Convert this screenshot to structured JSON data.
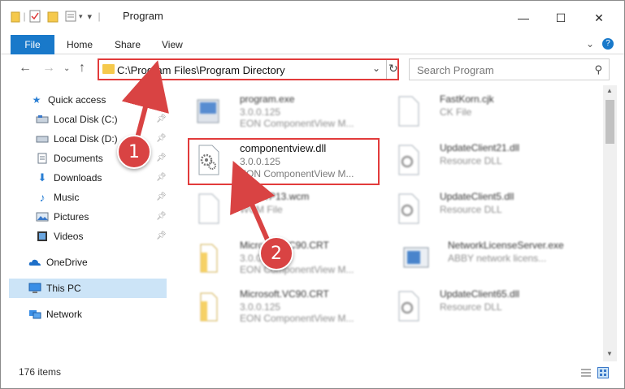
{
  "window": {
    "title": "Program",
    "buttons": {
      "minimize": "—",
      "maximize": "☐",
      "close": "✕"
    }
  },
  "ribbon": {
    "tabs": [
      "File",
      "Home",
      "Share",
      "View"
    ],
    "expand_icon": "⌄",
    "help_icon": "?"
  },
  "nav": {
    "address": "C:\\Program Files\\Program Directory",
    "search_placeholder": "Search Program"
  },
  "sidebar": {
    "items": [
      {
        "label": "Quick access",
        "icon": "star-icon",
        "pinned": false
      },
      {
        "label": "Local Disk (C:)",
        "icon": "drive-icon",
        "pinned": true
      },
      {
        "label": "Local Disk (D:)",
        "icon": "drive-icon",
        "pinned": true
      },
      {
        "label": "Documents",
        "icon": "documents-icon",
        "pinned": true
      },
      {
        "label": "Downloads",
        "icon": "download-icon",
        "pinned": true
      },
      {
        "label": "Music",
        "icon": "music-icon",
        "pinned": true
      },
      {
        "label": "Pictures",
        "icon": "pictures-icon",
        "pinned": true
      },
      {
        "label": "Videos",
        "icon": "videos-icon",
        "pinned": true
      },
      {
        "label": "OneDrive",
        "icon": "cloud-icon",
        "pinned": false
      },
      {
        "label": "This PC",
        "icon": "computer-icon",
        "pinned": false
      },
      {
        "label": "Network",
        "icon": "network-icon",
        "pinned": false
      }
    ]
  },
  "files": [
    {
      "name": "program.exe",
      "line2": "3.0.0.125",
      "line3": "EON ComponentView M...",
      "icon": "exe-icon"
    },
    {
      "name": "FastKorn.cjk",
      "line2": "CK File",
      "line3": "",
      "icon": "file-icon"
    },
    {
      "name": "componentview.dll",
      "line2": "3.0.0.125",
      "line3": "EON ComponentView M...",
      "icon": "dll-icon"
    },
    {
      "name": "UpdateClient21.dll",
      "line2": "Resource DLL",
      "line3": "",
      "icon": "dll-icon"
    },
    {
      "name": "S4...WP13.wcm",
      "line2": "WCM File",
      "line3": "",
      "icon": "file-icon"
    },
    {
      "name": "UpdateClient5.dll",
      "line2": "Resource DLL",
      "line3": "",
      "icon": "dll-icon"
    },
    {
      "name": "Microsoft.VC90.CRT",
      "line2": "3.0.0.125",
      "line3": "EON ComponentView M...",
      "icon": "folder-icon"
    },
    {
      "name": "NetworkLicenseServer.exe",
      "line2": "ABBY network licens...",
      "line3": "",
      "icon": "exe-icon"
    },
    {
      "name": "Microsoft.VC90.CRT",
      "line2": "3.0.0.125",
      "line3": "EON ComponentView M...",
      "icon": "folder-icon"
    },
    {
      "name": "UpdateClient65.dll",
      "line2": "Resource DLL",
      "line3": "",
      "icon": "dll-icon"
    }
  ],
  "status": {
    "item_count": "176 items"
  },
  "annotations": {
    "step1": "1",
    "step2": "2",
    "color": "#d94343"
  }
}
